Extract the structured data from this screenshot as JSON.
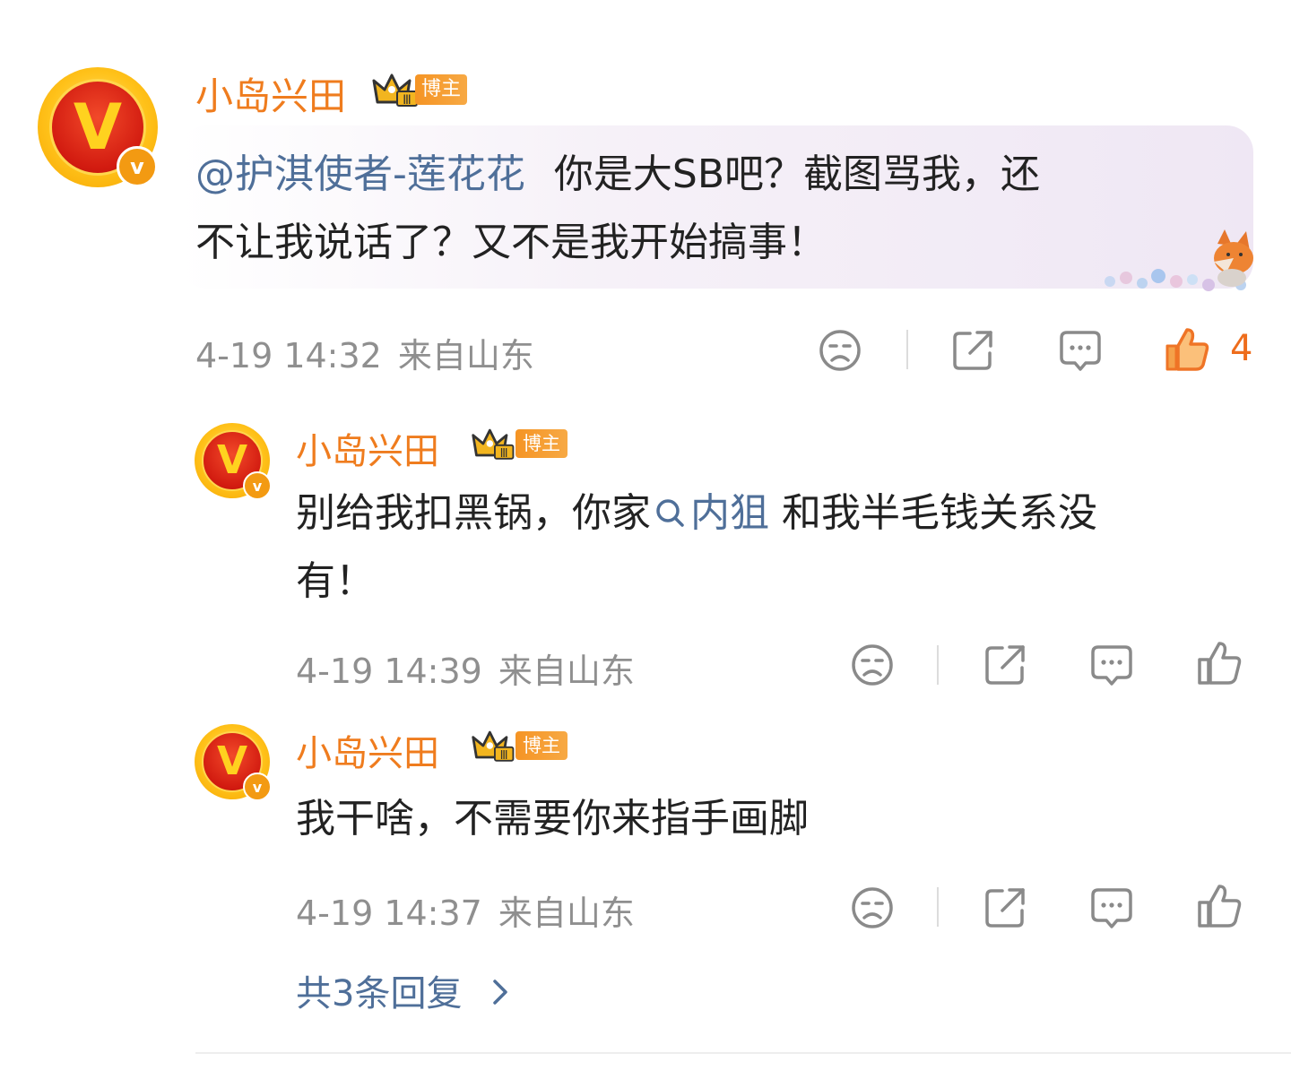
{
  "comment": {
    "username": "小岛兴田",
    "badge": "博主",
    "mention": "@护淇使者-莲花花",
    "text_line1": "你是大SB吧？截图骂我，还",
    "text_line2": "不让我说话了？又不是我开始搞事！",
    "time": "4-19 14:32",
    "location": "来自山东",
    "like_count": "4"
  },
  "replies": [
    {
      "username": "小岛兴田",
      "badge": "博主",
      "text_before": "别给我扣黑锅，你家",
      "topic": "内狙",
      "text_after": " 和我半毛钱关系没",
      "text_line2": "有！",
      "time": "4-19 14:39",
      "location": "来自山东"
    },
    {
      "username": "小岛兴田",
      "badge": "博主",
      "text": "我干啥，不需要你来指手画脚",
      "time": "4-19 14:37",
      "location": "来自山东"
    }
  ],
  "more_replies": "共3条回复",
  "avatar_letter": "V",
  "badge_letter": "v",
  "colors": {
    "username": "#ef7c1e",
    "link": "#4f6f99",
    "meta": "#8f8f8f",
    "like_active": "#ee6d1c"
  },
  "icons": [
    "dislike-icon",
    "share-icon",
    "comment-icon",
    "like-icon",
    "chevron-right-icon",
    "crown-icon"
  ]
}
